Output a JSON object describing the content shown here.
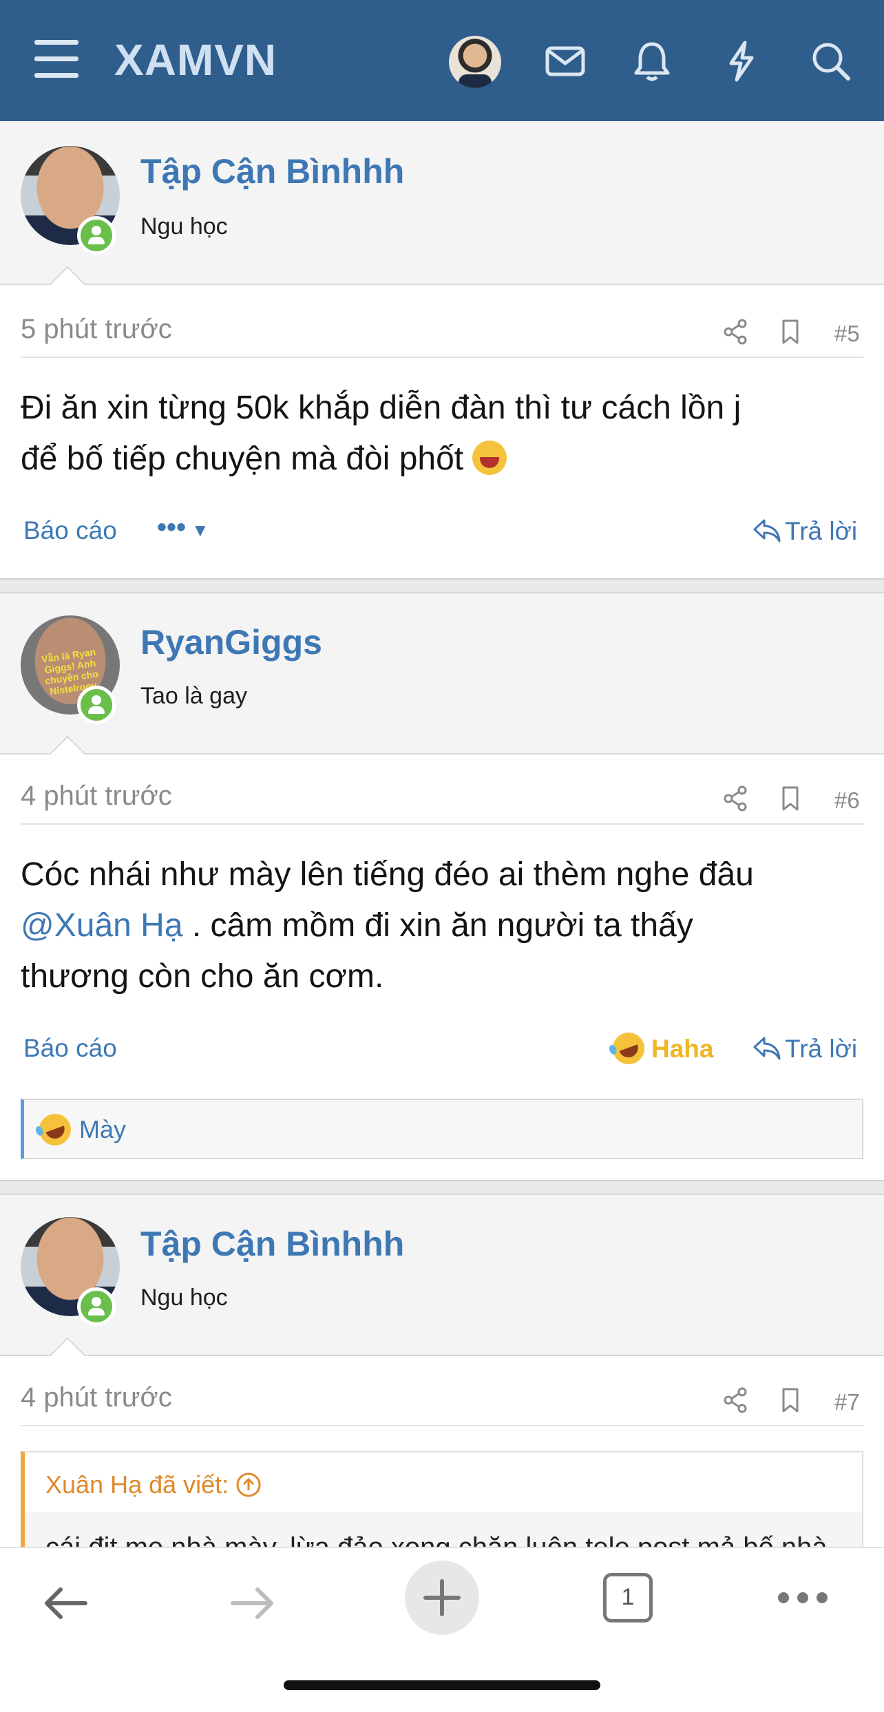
{
  "header": {
    "site_name": "XAMVN",
    "icons": [
      "menu-icon",
      "avatar",
      "envelope-icon",
      "bell-icon",
      "bolt-icon",
      "search-icon"
    ]
  },
  "posts": [
    {
      "username": "Tập Cận Bìnhhh",
      "user_title": "Ngu học",
      "time": "5 phút trước",
      "number": "#5",
      "message_lines": [
        "Đi ăn xin từng 50k khắp diễn đàn thì tư cách lồn j",
        "để bố tiếp chuyện mà đòi phốt"
      ],
      "report_label": "Báo cáo",
      "more_label": "•••",
      "reply_label": "Trả lời"
    },
    {
      "username": "RyanGiggs",
      "user_title": "Tao là gay",
      "avatar_text": "Vẫn là Ryan Giggs! Anh chuyền cho Nistelrooy",
      "time": "4 phút trước",
      "number": "#6",
      "message_line1": "Cóc nhái như mày lên tiếng đéo ai thèm nghe đâu",
      "mention": "@Xuân Hạ",
      "message_line2_rest": " . câm mồm đi xin ăn người ta thấy",
      "message_line3": "thương còn cho ăn cơm.",
      "report_label": "Báo cáo",
      "reaction_label": "Haha",
      "reply_label": "Trả lời",
      "reacted_by": "Mày"
    },
    {
      "username": "Tập Cận Bìnhhh",
      "user_title": "Ngu học",
      "time": "4 phút trước",
      "number": "#7",
      "quote_author": "Xuân Hạ đã viết:",
      "quote_text": "cái địt mẹ nhà mày. lừa đảo xong chặn luôn tele post mả bố nhà"
    }
  ],
  "browser_bar": {
    "tab_count": "1"
  }
}
